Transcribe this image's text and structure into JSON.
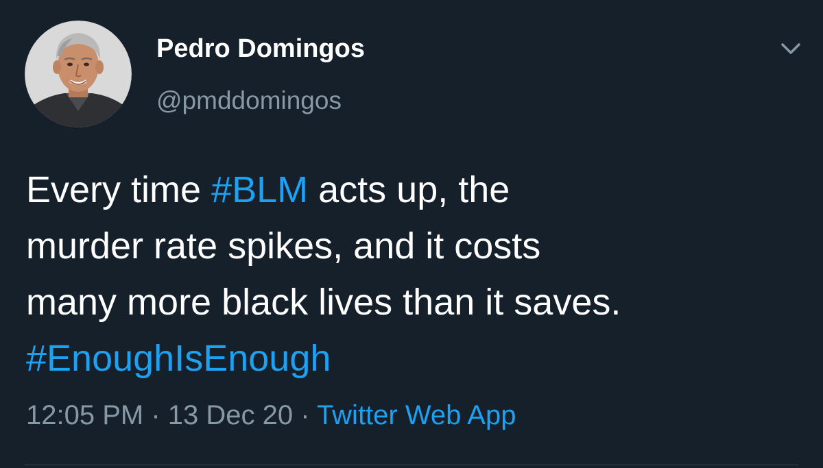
{
  "tweet": {
    "author": {
      "display_name": "Pedro Domingos",
      "handle": "@pmddomingos"
    },
    "text": {
      "line1_pre": "Every time ",
      "line1_tag": "#BLM",
      "line1_post": " acts up, the",
      "line2": "murder rate spikes, and it costs",
      "line3": "many more black lives than it saves.",
      "line4_tag": "#EnoughIsEnough"
    },
    "meta": {
      "time": "12:05 PM",
      "separator1": " · ",
      "date": "13 Dec 20",
      "separator2": " · ",
      "source": "Twitter Web App"
    },
    "icons": {
      "more_menu": "chevron-down-icon",
      "avatar": "avatar"
    },
    "colors": {
      "background": "#15202b",
      "primary_text": "#ffffff",
      "secondary_text": "#8899a6",
      "link": "#1da1f2"
    }
  }
}
